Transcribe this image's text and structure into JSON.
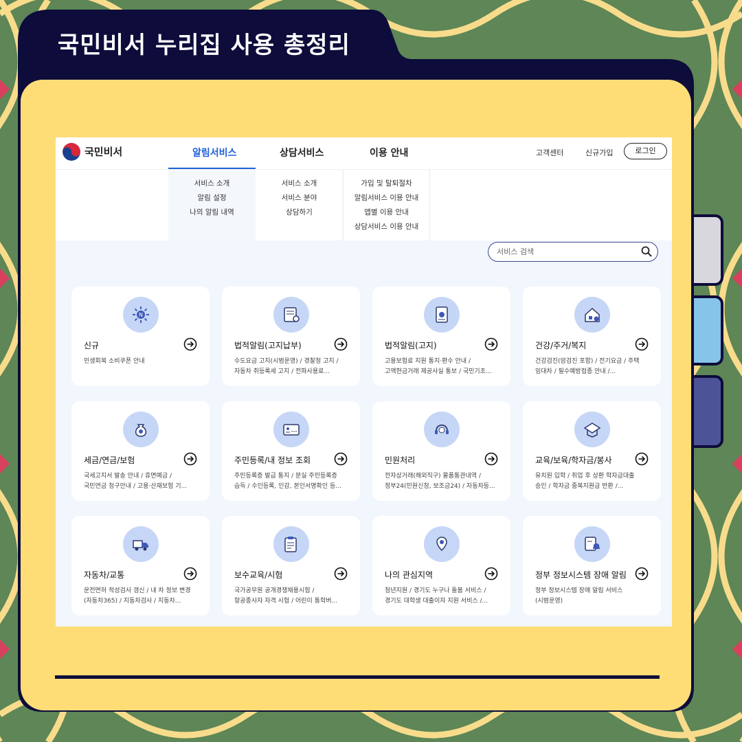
{
  "header": {
    "title": "국민비서 누리집 사용 총정리"
  },
  "site": {
    "logo_text": "국민비서",
    "nav": [
      "알림서비스",
      "상담서비스",
      "이용 안내"
    ],
    "nav_right": {
      "customer_center": "고객센터",
      "signup": "신규가입",
      "login": "로그인"
    },
    "menu": {
      "col1": [
        "서비스 소개",
        "알림 설정",
        "나의 알림 내역"
      ],
      "col2": [
        "서비스 소개",
        "서비스 분야",
        "상담하기"
      ],
      "col3": [
        "가입 및 탈퇴절차",
        "알림서비스 이용 안내",
        "앱별 이용 안내",
        "상담서비스 이용 안내"
      ]
    },
    "search": {
      "placeholder": "서비스 검색"
    }
  },
  "cards": [
    {
      "title": "신규",
      "icon": "new-badge-icon",
      "lines": [
        "민생회복 소비쿠폰 안내"
      ]
    },
    {
      "title": "법적알림(고지납부)",
      "icon": "bill-pay-icon",
      "lines": [
        "수도요금 고지(시범운영) / 경찰청 고지 /",
        "자동차 취등록세 고지 / 전파사용료..."
      ]
    },
    {
      "title": "법적알림(고지)",
      "icon": "legal-notice-icon",
      "lines": [
        "고용보험료 지원 통지·환수 안내 /",
        "고액현금거래 제공사실 통보 / 국민기초..."
      ]
    },
    {
      "title": "건강/주거/복지",
      "icon": "house-welfare-icon",
      "lines": [
        "건강검진(암검진 포함) / 전기요금 / 주택",
        "임대차 / 필수예방접종 안내 /..."
      ]
    },
    {
      "title": "세금/연금/보험",
      "icon": "money-bag-icon",
      "lines": [
        "국세고지서 발송 안내 / 휴면예금 /",
        "국민연금 청구안내 / 고용·산재보험 기..."
      ]
    },
    {
      "title": "주민등록/내 정보 조회",
      "icon": "id-card-icon",
      "lines": [
        "주민등록증 발급 통지 / 분실 주민등록증",
        "습득 / 수인등록, 인감, 본인서명확인 등..."
      ]
    },
    {
      "title": "민원처리",
      "icon": "headset-icon",
      "lines": [
        "전자상거래(해외직구) 물품통관내역 /",
        "정부24(민원신청, 보조금24) / 자동차등..."
      ]
    },
    {
      "title": "교육/보육/학자금/봉사",
      "icon": "education-icon",
      "lines": [
        "유치원 입학 / 취업 후 상환 학자금대출",
        "승인 / 학자금 중복지원금 반환 /..."
      ]
    },
    {
      "title": "자동차/교통",
      "icon": "truck-icon",
      "lines": [
        "운전면허 적성검사 갱신 / 내 차 정보 변경",
        "(자동차365) / 지동차검사 / 지동차..."
      ]
    },
    {
      "title": "보수교육/시험",
      "icon": "clipboard-exam-icon",
      "lines": [
        "국가공무원 공개경쟁채용시험 /",
        "항공종사자 자격 시험 / 어린이 통학버..."
      ]
    },
    {
      "title": "나의 관심지역",
      "icon": "location-map-icon",
      "lines": [
        "청년지원 / 경기도 누구나 돌봄 서비스 /",
        "경기도 대학생 대출이자 지원 서비스 /..."
      ]
    },
    {
      "title": "정부 정보시스템 장애 알림",
      "icon": "system-alert-icon",
      "lines": [
        "정부 정보시스템 장애 알림 서비스",
        "(시범운영)"
      ]
    }
  ],
  "colors": {
    "navy": "#0d0c3b",
    "yellow": "#fedd77",
    "green": "#5e8656",
    "accent_blue": "#1e5fd8",
    "icon_bg": "#c6d6f6"
  }
}
